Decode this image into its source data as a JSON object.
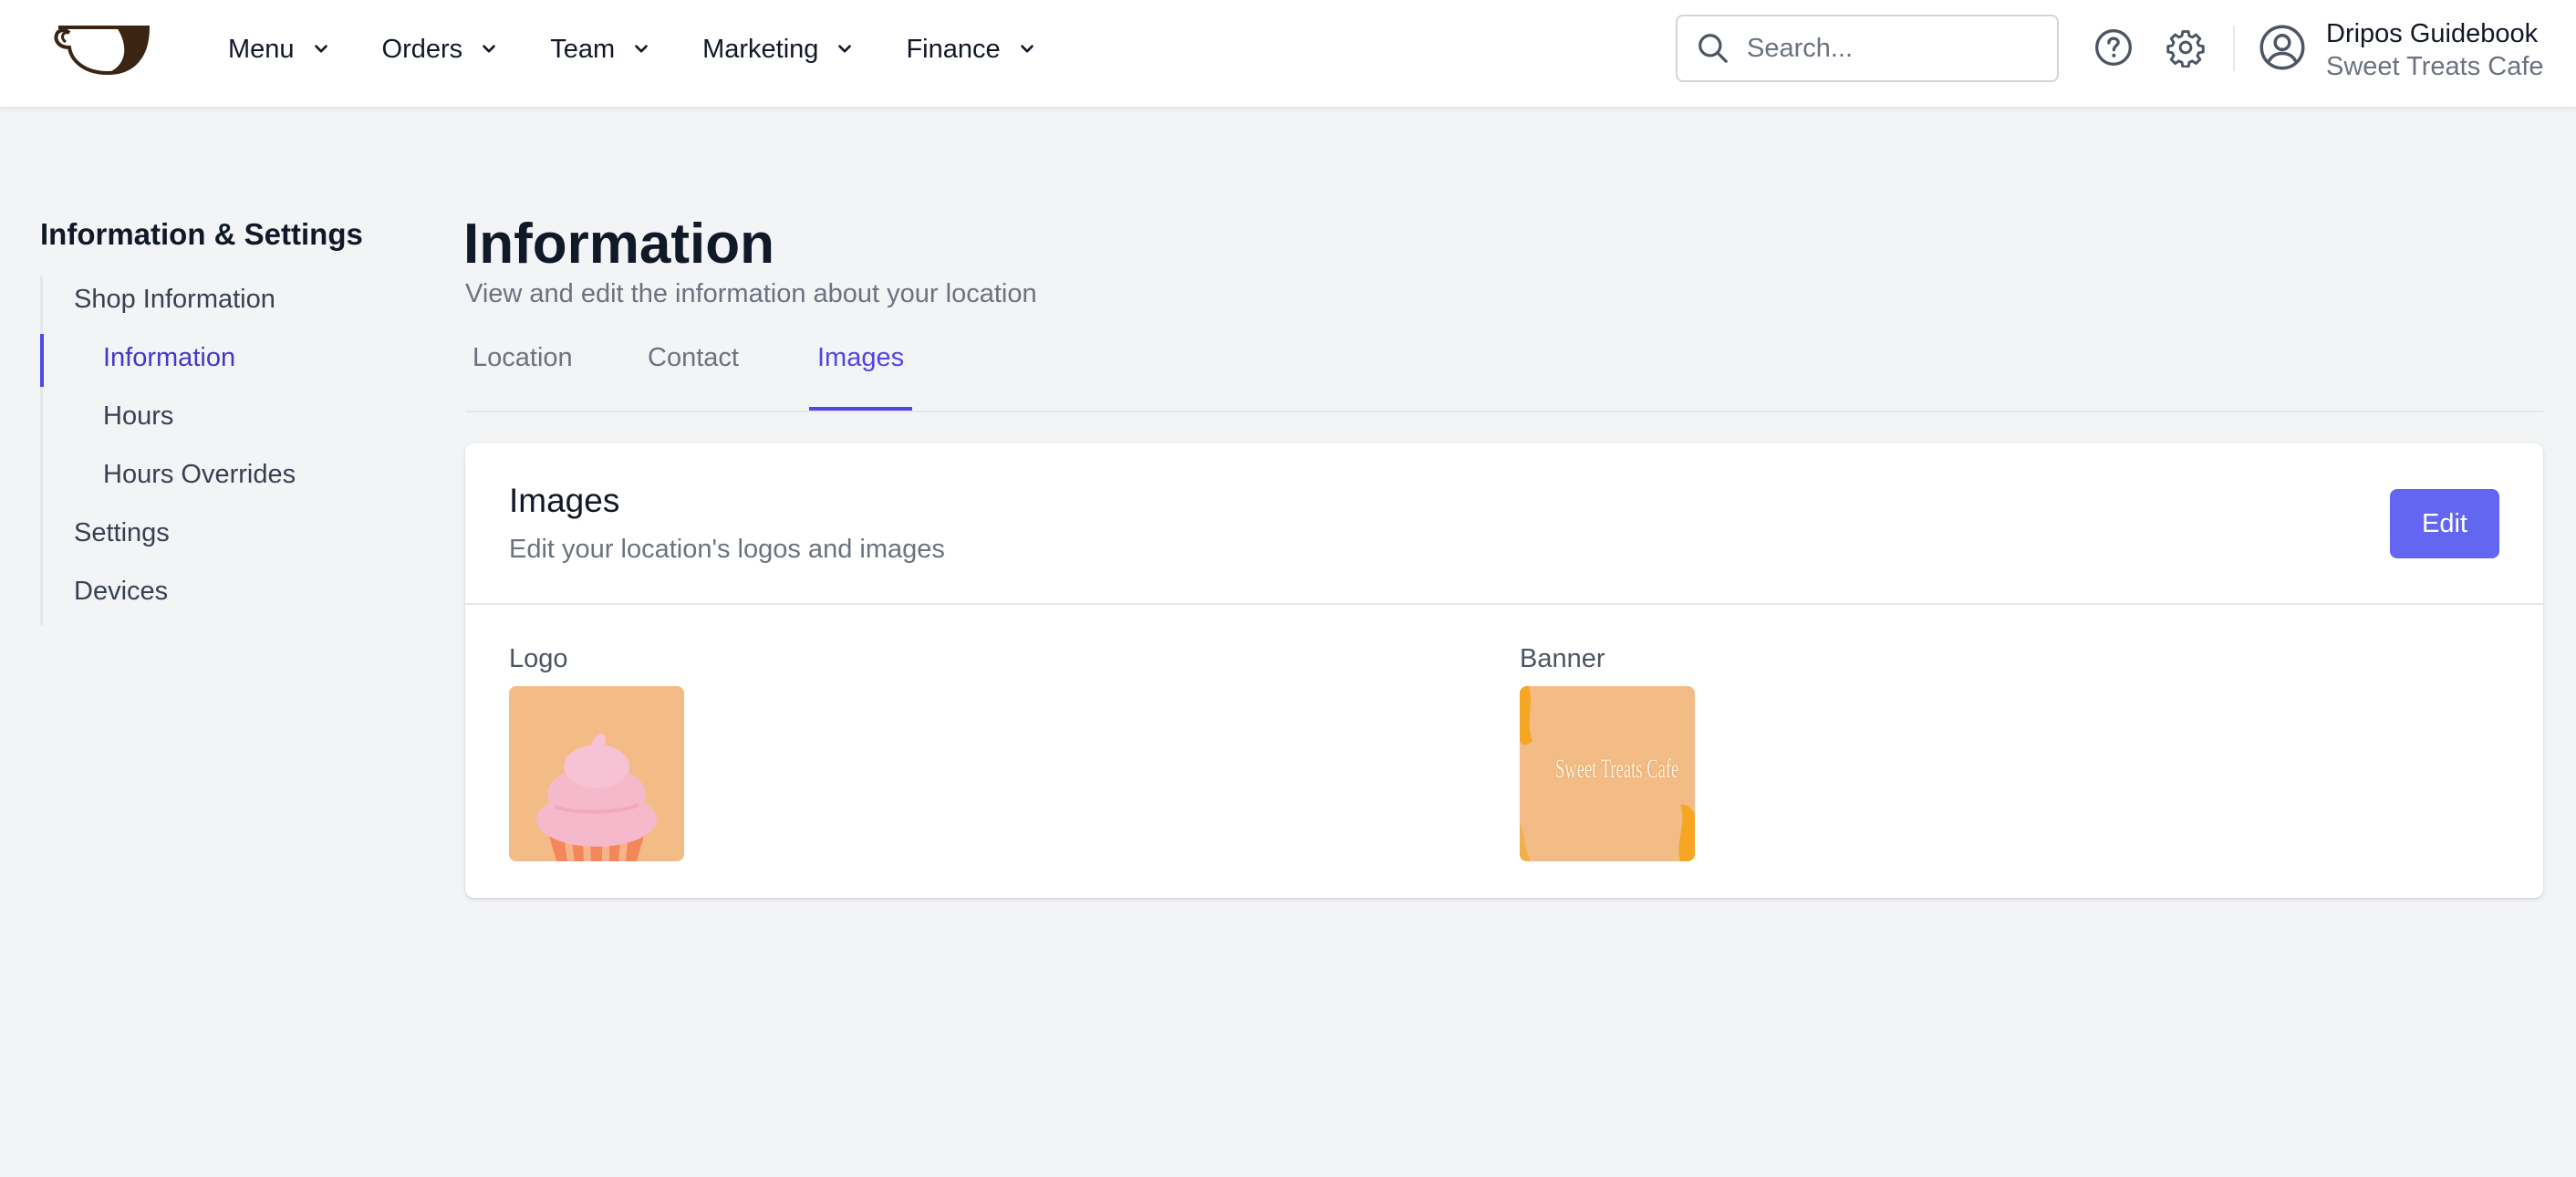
{
  "topbar": {
    "logo_icon": "coffee-cup-logo",
    "nav": [
      {
        "label": "Menu"
      },
      {
        "label": "Orders"
      },
      {
        "label": "Team"
      },
      {
        "label": "Marketing"
      },
      {
        "label": "Finance"
      }
    ],
    "search_placeholder": "Search...",
    "help_icon": "question-circle-icon",
    "settings_icon": "gear-icon",
    "account": {
      "name": "Dripos Guidebook",
      "location": "Sweet Treats Cafe"
    }
  },
  "sidebar": {
    "title": "Information & Settings",
    "items": [
      {
        "label": "Shop Information"
      },
      {
        "label": "Information",
        "active": true
      },
      {
        "label": "Hours"
      },
      {
        "label": "Hours Overrides"
      },
      {
        "label": "Settings"
      },
      {
        "label": "Devices"
      }
    ]
  },
  "main": {
    "title": "Information",
    "subtitle": "View and edit the information about your location",
    "tabs": [
      {
        "label": "Location"
      },
      {
        "label": "Contact"
      },
      {
        "label": "Images",
        "active": true
      }
    ],
    "card": {
      "title": "Images",
      "description": "Edit your location's logos and images",
      "edit_label": "Edit",
      "logo_label": "Logo",
      "banner_label": "Banner",
      "banner_text": "Sweet Treats Cafe"
    }
  },
  "colors": {
    "accent": "#6366f1",
    "active_text": "#4338ca",
    "thumb_bg": "#f3bb86"
  }
}
